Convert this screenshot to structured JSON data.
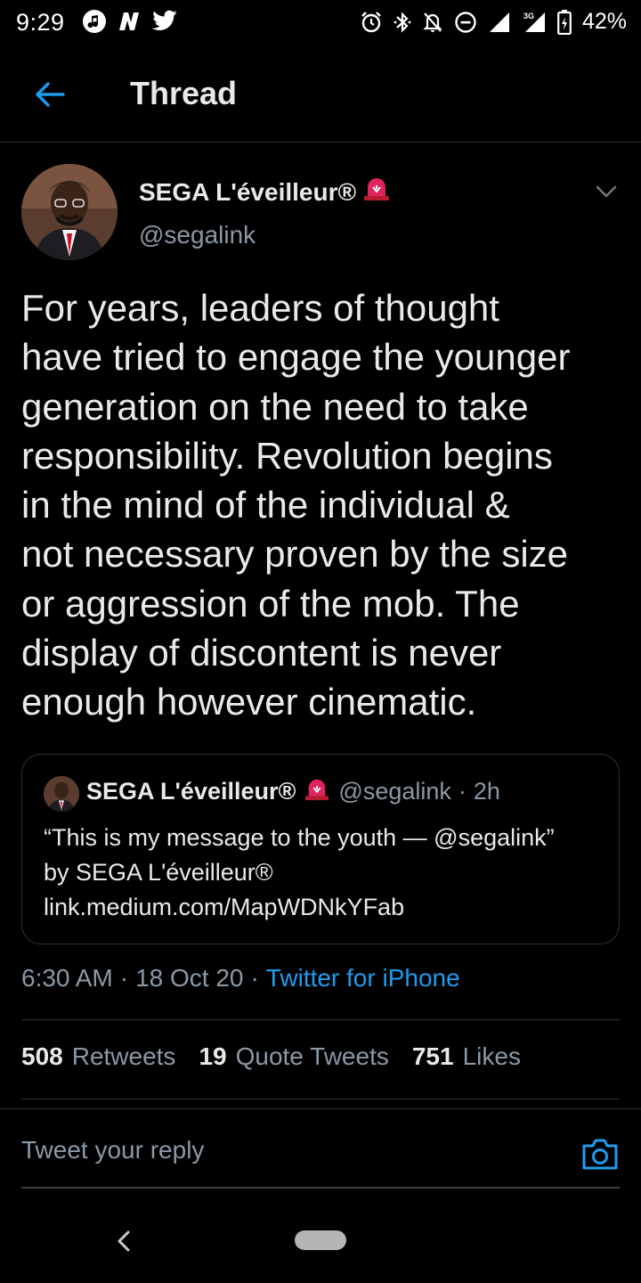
{
  "status_bar": {
    "time": "9:29",
    "battery": "42%",
    "network": "3G",
    "left_icons": [
      "music-note-icon",
      "news-icon",
      "twitter-bird-icon"
    ],
    "right_icons": [
      "alarm-icon",
      "bluetooth-icon",
      "mute-icon",
      "dnd-icon",
      "signal-icon",
      "signal-3g-icon",
      "battery-icon"
    ]
  },
  "nav": {
    "title": "Thread"
  },
  "tweet": {
    "author_name": "SEGA L'éveilleur®",
    "author_handle": "@segalink",
    "text_lines": [
      "For years, leaders of thought",
      "have tried to engage the younger",
      "generation on the need to take",
      "responsibility. Revolution begins",
      "in the mind of the individual &",
      "not necessary proven by the size",
      "or aggression of the mob. The",
      "display of discontent is never",
      "enough however cinematic."
    ],
    "time": "6:30 AM",
    "date": "18 Oct 20",
    "source": "Twitter for iPhone",
    "meta_sep": "·"
  },
  "quote": {
    "author_name": "SEGA L'éveilleur®",
    "author_handle": "@segalink",
    "sep": "·",
    "time": "2h",
    "body_lines": [
      "“This is my message to the youth — @segalink”",
      "by SEGA L'éveilleur®",
      "link.medium.com/MapWDNkYFab"
    ]
  },
  "stats": {
    "retweets_count": "508",
    "retweets_label": "Retweets",
    "quotes_count": "19",
    "quotes_label": "Quote Tweets",
    "likes_count": "751",
    "likes_label": "Likes"
  },
  "reply": {
    "placeholder": "Tweet your reply"
  },
  "colors": {
    "background": "#000000",
    "accent": "#1d9bf0",
    "secondary_text": "#8b98a5",
    "siren_red": "#e0245e"
  }
}
